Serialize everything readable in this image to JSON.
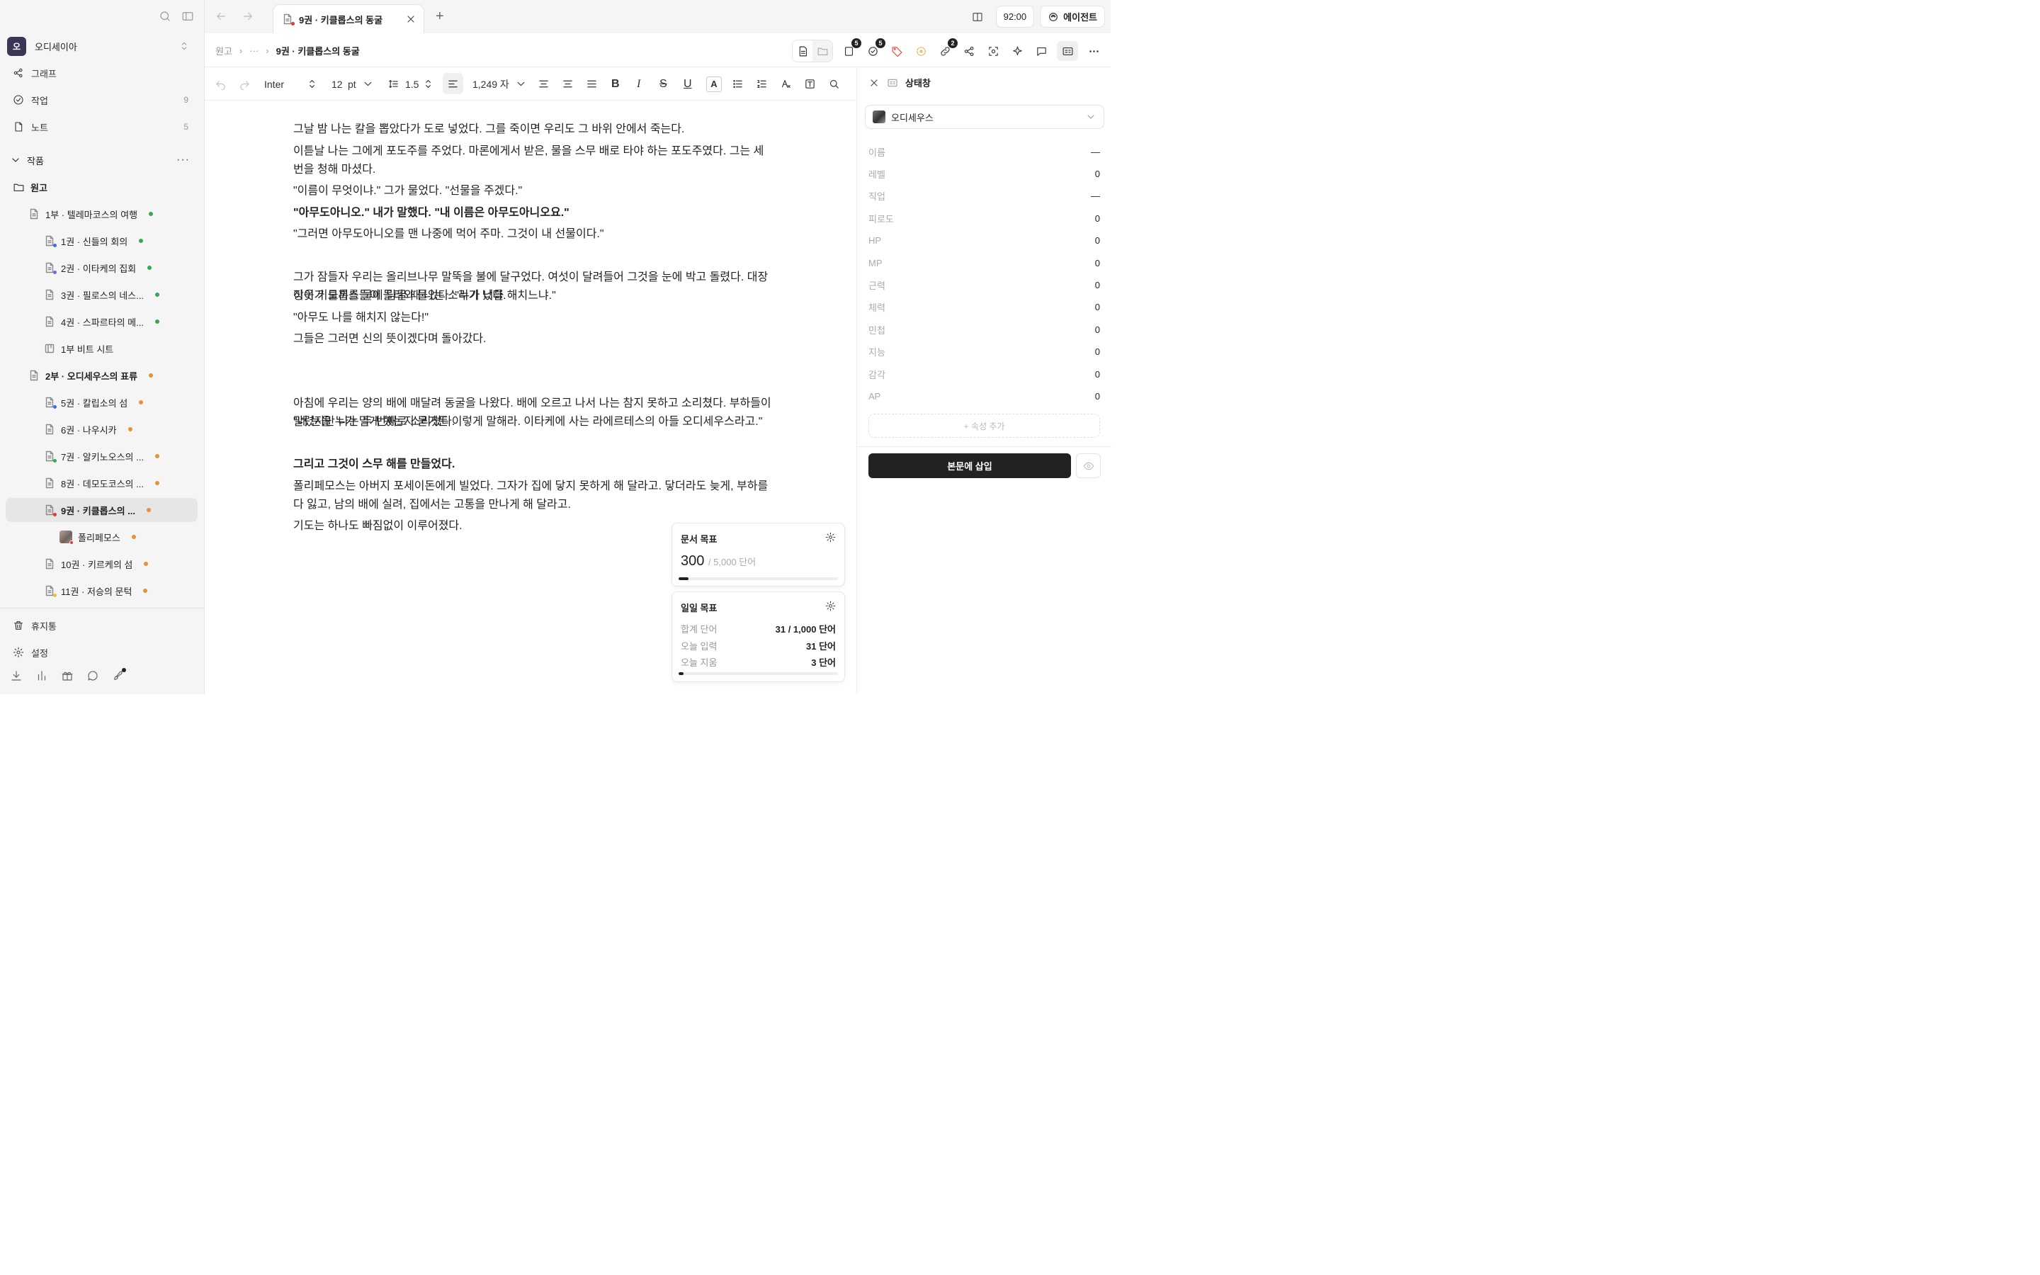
{
  "sidebar": {
    "workspace": {
      "initial": "오",
      "name": "오디세이아"
    },
    "nav": [
      {
        "label": "그래프",
        "count": ""
      },
      {
        "label": "작업",
        "count": "9"
      },
      {
        "label": "노트",
        "count": "5"
      }
    ],
    "section_title": "작품",
    "tree": [
      {
        "label": "원고",
        "kind": "folder"
      },
      {
        "label": "1부 · 텔레마코스의 여행",
        "dot": "#34a853",
        "bold": false
      },
      {
        "label": "1권 · 신들의 회의",
        "dot": "#34a853",
        "sub": "#3b6fd8"
      },
      {
        "label": "2권 · 이타케의 집회",
        "dot": "#34a853",
        "sub": "#8e5bd8"
      },
      {
        "label": "3권 · 필로스의 네스...",
        "dot": "#34a853"
      },
      {
        "label": "4권 · 스파르타의 메...",
        "dot": "#34a853"
      },
      {
        "label": "1부 비트 시트",
        "kind": "sheet"
      },
      {
        "label": "2부 · 오디세우스의 표류",
        "dot": "#e8913a",
        "bold": true
      },
      {
        "label": "5권 · 칼립소의 섬",
        "dot": "#e8913a",
        "sub": "#3b6fd8"
      },
      {
        "label": "6권 · 나우시카",
        "dot": "#e8913a"
      },
      {
        "label": "7권 · 알키노오스의 ...",
        "dot": "#e8913a",
        "sub": "#34a853"
      },
      {
        "label": "8권 · 데모도코스의 ...",
        "dot": "#e8913a"
      },
      {
        "label": "9권 · 키클롭스의 ...",
        "dot": "#e8913a",
        "sub": "#d93b3b",
        "selected": true,
        "bold": true
      },
      {
        "label": "폴리페모스",
        "dot": "#e8913a",
        "kind": "character"
      },
      {
        "label": "10권 · 키르케의 섬",
        "dot": "#e8913a"
      },
      {
        "label": "11권 · 저승의 문턱",
        "dot": "#e8913a",
        "sub": "#e8c23a"
      }
    ],
    "trash": "휴지통",
    "settings": "설정"
  },
  "tabbar": {
    "tab_title": "9권 · 키클롭스의 동굴",
    "time": "92:00",
    "agent": "에이전트"
  },
  "breadcrumb": {
    "root": "원고",
    "ellipsis": "···",
    "current": "9권 · 키클롭스의 동굴",
    "badges": {
      "pages": "5",
      "tasks": "5",
      "links": "2"
    }
  },
  "toolbar": {
    "font": "Inter",
    "size": "12",
    "unit": "pt",
    "line_height": "1.5",
    "word_count": "1,249 자"
  },
  "editor": {
    "paragraphs": [
      {
        "text": "그날 밤 나는 칼을 뽑았다가 도로 넣었다. 그를 죽이면 우리도 그 바위 안에서 죽는다.",
        "bold": false
      },
      {
        "text": "이튿날 나는 그에게 포도주를 주었다. 마론에게서 받은, 물을 스무 배로 타야 하는 포도주였다. 그는 세 번을 청해 마셨다.",
        "bold": false
      },
      {
        "text": "\"이름이 무엇이냐.\" 그가 물었다. \"선물을 주겠다.\"",
        "bold": false
      },
      {
        "text": "\"아무도아니오.\" 내가 말했다. \"내 이름은 아무도아니오요.\"",
        "bold": true
      },
      {
        "text": "\"그러면 아무도아니오를 맨 나중에 먹어 주마. 그것이 내 선물이다.\"",
        "bold": false
      },
      {
        "text": "그가 잠들자 우리는 올리브나무 말뚝을 불에 달구었다. 여섯이 달려들어 그것을 눈에 박고 돌렸다. 대장장이가 도끼를 물에 담글 때 나는 소리가 났다.",
        "bold": false
      },
      {
        "text": "이웃 키클롭스들이 몰려와 물었다. \"누가 너를 해치느냐.\"",
        "bold": false
      },
      {
        "text": "\"아무도 나를 해치지 않는다!\"",
        "bold": false
      },
      {
        "text": "그들은 그러면 신의 뜻이겠다며 돌아갔다.",
        "bold": false
      },
      {
        "text": "아침에 우리는 양의 배에 매달려 동굴을 나왔다. 배에 오르고 나서 나는 참지 못하고 소리쳤다. 부하들이 말렸지만 나는 두 번째로 소리쳤다.",
        "bold": false
      },
      {
        "text": "\"네 눈을 누가 멀게 했는지 묻거든 이렇게 말해라. 이타케에 사는 라에르테스의 아들 오디세우스라고.\"",
        "bold": false
      },
      {
        "text": "그리고 그것이 스무 해를 만들었다.",
        "bold": true
      },
      {
        "text": "폴리페모스는 아버지 포세이돈에게 빌었다. 그자가 집에 닿지 못하게 해 달라고. 닿더라도 늦게, 부하를 다 잃고, 남의 배에 실려, 집에서는 고통을 만나게 해 달라고.",
        "bold": false
      },
      {
        "text": "기도는 하나도 빠짐없이 이루어졌다.",
        "bold": false
      }
    ]
  },
  "doc_goal": {
    "title": "문서 목표",
    "current": "300",
    "target": "/ 5,000 단어",
    "progress": 0.06
  },
  "daily_goal": {
    "title": "일일 목표",
    "rows": [
      {
        "k": "합계 단어",
        "v": "31 / 1,000 단어"
      },
      {
        "k": "오늘 입력",
        "v": "31 단어"
      },
      {
        "k": "오늘 지움",
        "v": "3 단어"
      }
    ],
    "progress": 0.031
  },
  "status_panel": {
    "title": "상태창",
    "character": "오디세우스",
    "props": [
      {
        "k": "이름",
        "v": "—"
      },
      {
        "k": "레벨",
        "v": "0"
      },
      {
        "k": "직업",
        "v": "—"
      },
      {
        "k": "피로도",
        "v": "0"
      },
      {
        "k": "HP",
        "v": "0"
      },
      {
        "k": "MP",
        "v": "0"
      },
      {
        "k": "근력",
        "v": "0"
      },
      {
        "k": "체력",
        "v": "0"
      },
      {
        "k": "민첩",
        "v": "0"
      },
      {
        "k": "지능",
        "v": "0"
      },
      {
        "k": "감각",
        "v": "0"
      },
      {
        "k": "AP",
        "v": "0"
      }
    ],
    "add_prop": "+ 속성 추가",
    "insert_label": "본문에 삽입"
  }
}
